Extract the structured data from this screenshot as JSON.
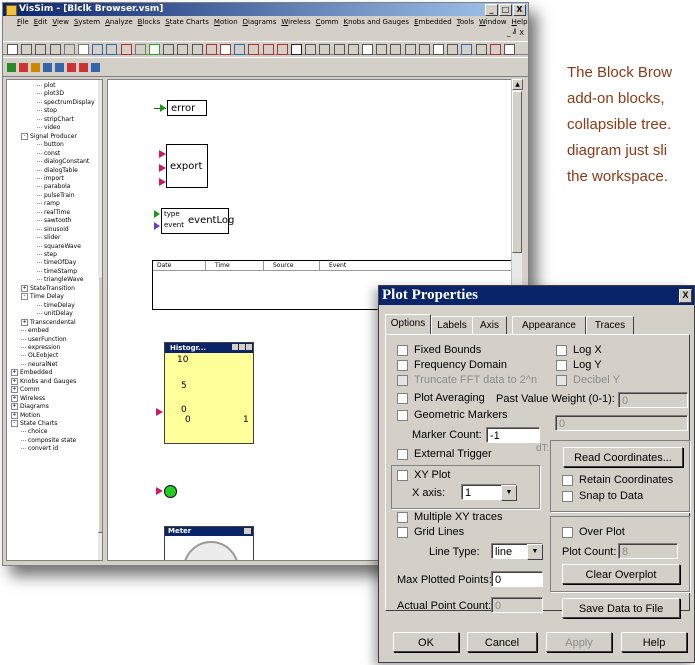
{
  "app": {
    "title": "VisSim - [Blclk Browser.vsm]",
    "window_buttons": [
      "_",
      "□",
      "X"
    ],
    "mdi_buttons": "_ ╝ X"
  },
  "menubar": [
    "File",
    "Edit",
    "View",
    "System",
    "Analyze",
    "Blocks",
    "State Charts",
    "Motion",
    "Diagrams",
    "Wireless",
    "Comm",
    "Knobs and Gauges",
    "Embedded",
    "Tools",
    "Window",
    "Help"
  ],
  "description": [
    "The Block Brow",
    "add-on blocks,",
    "collapsible tree.",
    "diagram just sli",
    "the workspace."
  ],
  "tree": [
    {
      "label": "plot",
      "level": 2
    },
    {
      "label": "plot3D",
      "level": 2
    },
    {
      "label": "spectrumDisplay",
      "level": 2
    },
    {
      "label": "stop",
      "level": 2
    },
    {
      "label": "stripChart",
      "level": 2
    },
    {
      "label": "video",
      "level": 2
    },
    {
      "label": "Signal Producer",
      "level": 1,
      "toggle": "-"
    },
    {
      "label": "button",
      "level": 2
    },
    {
      "label": "const",
      "level": 2
    },
    {
      "label": "dialogConstant",
      "level": 2
    },
    {
      "label": "dialogTable",
      "level": 2
    },
    {
      "label": "import",
      "level": 2
    },
    {
      "label": "parabola",
      "level": 2
    },
    {
      "label": "pulseTrain",
      "level": 2
    },
    {
      "label": "ramp",
      "level": 2
    },
    {
      "label": "realTime",
      "level": 2
    },
    {
      "label": "sawtooth",
      "level": 2
    },
    {
      "label": "sinusoid",
      "level": 2
    },
    {
      "label": "slider",
      "level": 2
    },
    {
      "label": "squareWave",
      "level": 2
    },
    {
      "label": "step",
      "level": 2
    },
    {
      "label": "timeOfDay",
      "level": 2
    },
    {
      "label": "timeStamp",
      "level": 2
    },
    {
      "label": "triangleWave",
      "level": 2
    },
    {
      "label": "StateTransition",
      "level": 1,
      "toggle": "+"
    },
    {
      "label": "Time Delay",
      "level": 1,
      "toggle": "-"
    },
    {
      "label": "timeDelay",
      "level": 2
    },
    {
      "label": "unitDelay",
      "level": 2
    },
    {
      "label": "Transcendental",
      "level": 1,
      "toggle": "+"
    },
    {
      "label": "embed",
      "level": 1
    },
    {
      "label": "userFunction",
      "level": 1
    },
    {
      "label": "expression",
      "level": 1
    },
    {
      "label": "OLEobject",
      "level": 1
    },
    {
      "label": "neuralNet",
      "level": 1
    },
    {
      "label": "Embedded",
      "level": 0,
      "toggle": "+"
    },
    {
      "label": "Knobs and Gauges",
      "level": 0,
      "toggle": "+"
    },
    {
      "label": "Comm",
      "level": 0,
      "toggle": "+"
    },
    {
      "label": "Wireless",
      "level": 0,
      "toggle": "+"
    },
    {
      "label": "Diagrams",
      "level": 0,
      "toggle": "+"
    },
    {
      "label": "Motion",
      "level": 0,
      "toggle": "+"
    },
    {
      "label": "State Charts",
      "level": 0,
      "toggle": "-"
    },
    {
      "label": "choice",
      "level": 1
    },
    {
      "label": "composite state",
      "level": 1
    },
    {
      "label": "convert id",
      "level": 1
    }
  ],
  "canvas": {
    "error_label": "error",
    "export_label": "export",
    "eventlog_label": "eventLog",
    "eventlog_type": "type",
    "eventlog_event": "event",
    "log_columns": [
      "Date",
      "Time",
      "Source",
      "Event"
    ],
    "histogram": {
      "title": "Histogr...",
      "y_top": "10",
      "y_mid": "5",
      "y_bot": "0",
      "x_left": "0",
      "x_right": "1"
    },
    "meter_title": "Meter"
  },
  "dialog": {
    "title": "Plot Properties",
    "close": "X",
    "tabs": [
      "Options",
      "Labels",
      "Axis",
      "Appearance",
      "Traces"
    ],
    "fixed_bounds": "Fixed Bounds",
    "frequency_domain": "Frequency Domain",
    "truncate_fft": "Truncate FFT data to 2^n",
    "log_x": "Log X",
    "log_y": "Log Y",
    "decibel_y": "Decibel Y",
    "plot_averaging": "Plot Averaging",
    "past_value_weight_label": "Past Value Weight (0-1):",
    "past_value_weight_value": "0",
    "geometric_markers": "Geometric Markers",
    "marker_count_label": "Marker Count:",
    "marker_count_value": "-1",
    "external_trigger": "External Trigger",
    "partial_field_value": "0",
    "partial_dt": "dT:",
    "read_coordinates": "Read Coordinates...",
    "retain_coordinates": "Retain Coordinates",
    "snap_to_data": "Snap to Data",
    "xy_plot": "XY Plot",
    "x_axis_label": "X axis:",
    "x_axis_value": "1",
    "multiple_xy": "Multiple XY traces",
    "grid_lines": "Grid Lines",
    "line_type_label": "Line Type:",
    "line_type_value": "line",
    "over_plot": "Over Plot",
    "plot_count_label": "Plot Count:",
    "plot_count_value": "8",
    "clear_overplot": "Clear Overplot",
    "max_plotted_label": "Max Plotted Points:",
    "max_plotted_value": "0",
    "actual_count_label": "Actual Point Count:",
    "actual_count_value": "0",
    "save_data": "Save Data to File",
    "ok": "OK",
    "cancel": "Cancel",
    "apply": "Apply",
    "help": "Help"
  },
  "colors": {
    "title_blue": "#0a246a",
    "block_yellow": "#ffff99",
    "desc_text": "#8a3a14",
    "input_arrow": "#cc1a66"
  }
}
